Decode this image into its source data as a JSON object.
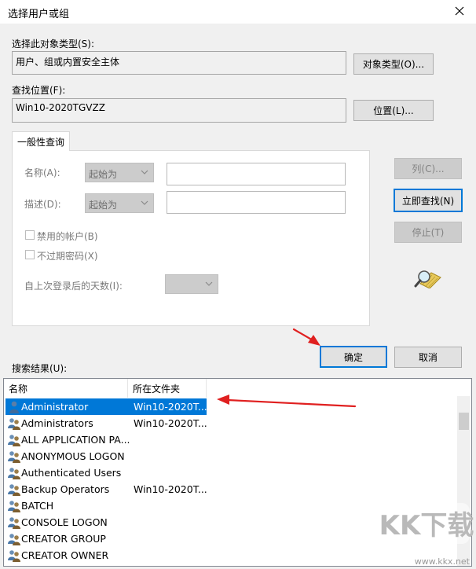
{
  "window": {
    "title": "选择用户或组"
  },
  "object_type": {
    "label": "选择此对象类型(S):",
    "value": "用户、组或内置安全主体",
    "button": "对象类型(O)..."
  },
  "location": {
    "label": "查找位置(F):",
    "value": "Win10-2020TGVZZ",
    "button": "位置(L)..."
  },
  "query_tab": {
    "label": "一般性查询"
  },
  "query": {
    "name_label": "名称(A):",
    "name_op": "起始为",
    "desc_label": "描述(D):",
    "desc_op": "起始为",
    "disabled_accounts": "禁用的帐户(B)",
    "non_expiring": "不过期密码(X)",
    "days_since_logon": "自上次登录后的天数(I):"
  },
  "side_buttons": {
    "columns": "列(C)...",
    "find_now": "立即查找(N)",
    "stop": "停止(T)"
  },
  "dialog_buttons": {
    "ok": "确定",
    "cancel": "取消"
  },
  "results": {
    "label": "搜索结果(U):",
    "columns": [
      "名称",
      "所在文件夹"
    ],
    "rows": [
      {
        "name": "Administrator",
        "folder": "Win10-2020T...",
        "icon": "user-icon",
        "selected": true
      },
      {
        "name": "Administrators",
        "folder": "Win10-2020T...",
        "icon": "group-icon"
      },
      {
        "name": "ALL APPLICATION PA...",
        "folder": "",
        "icon": "group-icon"
      },
      {
        "name": "ANONYMOUS LOGON",
        "folder": "",
        "icon": "group-icon"
      },
      {
        "name": "Authenticated Users",
        "folder": "",
        "icon": "group-icon"
      },
      {
        "name": "Backup Operators",
        "folder": "Win10-2020T...",
        "icon": "group-icon"
      },
      {
        "name": "BATCH",
        "folder": "",
        "icon": "group-icon"
      },
      {
        "name": "CONSOLE LOGON",
        "folder": "",
        "icon": "group-icon"
      },
      {
        "name": "CREATOR GROUP",
        "folder": "",
        "icon": "group-icon"
      },
      {
        "name": "CREATOR OWNER",
        "folder": "",
        "icon": "group-icon"
      }
    ]
  },
  "watermark": {
    "logo_text": "KK下载",
    "url": "www.kkx.net"
  },
  "colors": {
    "accent": "#0078d7",
    "annotation_arrow": "#e02020"
  }
}
